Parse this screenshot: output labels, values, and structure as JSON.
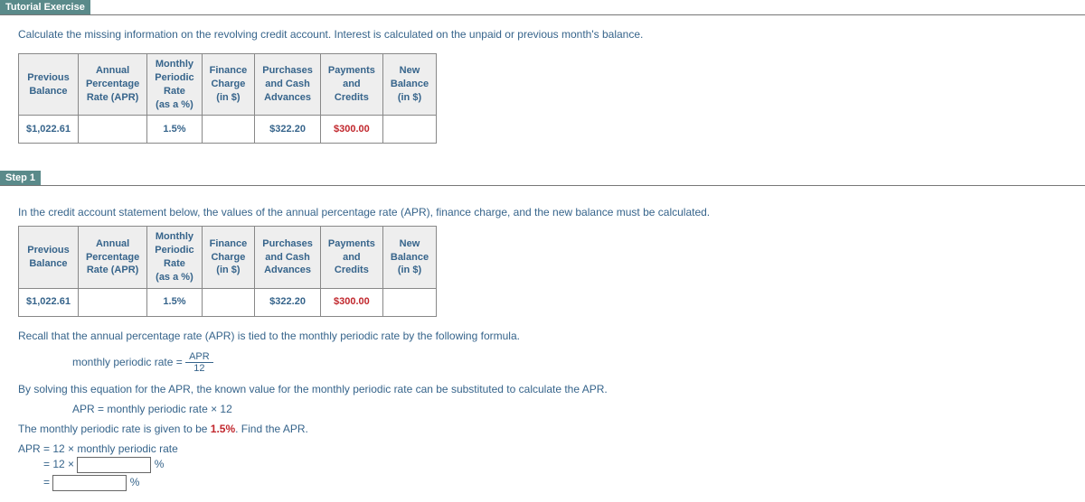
{
  "tutorial": {
    "header": "Tutorial Exercise",
    "instruction": "Calculate the missing information on the revolving credit account. Interest is calculated on the unpaid or previous month's balance."
  },
  "table_headers": {
    "prev_balance": "Previous\nBalance",
    "apr": "Annual\nPercentage\nRate (APR)",
    "mpr": "Monthly\nPeriodic\nRate\n(as a %)",
    "finance": "Finance\nCharge\n(in $)",
    "purchases": "Purchases\nand Cash\nAdvances",
    "payments": "Payments\nand\nCredits",
    "new_balance": "New\nBalance\n(in $)"
  },
  "row1": {
    "prev_balance": "$1,022.61",
    "apr": "",
    "mpr": "1.5%",
    "finance": "",
    "purchases": "$322.20",
    "payments": "$300.00",
    "new_balance": ""
  },
  "step1": {
    "header": "Step 1",
    "intro": "In the credit account statement below, the values of the annual percentage rate (APR), finance charge, and the new balance must be calculated.",
    "recall": "Recall that the annual percentage rate (APR) is tied to the monthly periodic rate by the following formula.",
    "formula_lhs": "monthly periodic rate =",
    "formula_num": "APR",
    "formula_den": "12",
    "solve_text": "By solving this equation for the APR, the known value for the monthly periodic rate can be substituted to calculate the APR.",
    "apr_eq": "APR = monthly periodic rate × 12",
    "mpr_given": "The monthly periodic rate is given to be ",
    "mpr_value": "1.5%",
    "mpr_tail": ". Find the APR.",
    "line1": "APR = 12 × monthly periodic rate",
    "line2_pre": "= 12 ×",
    "pct": "%",
    "line3_pre": "="
  }
}
